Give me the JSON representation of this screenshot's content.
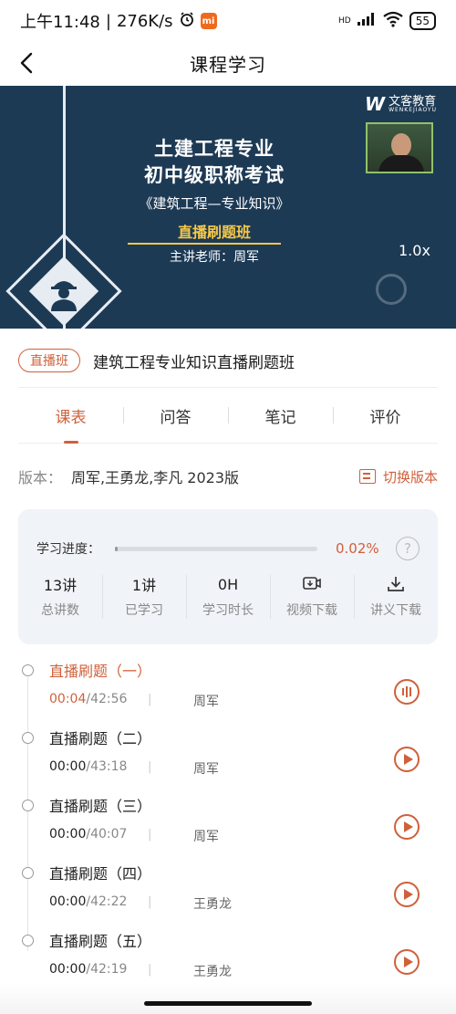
{
  "status_bar": {
    "time": "上午11:48",
    "net_speed": "276K/s",
    "battery": "55",
    "hd_label": "HD"
  },
  "header": {
    "title": "课程学习",
    "back_icon": "chevron-left-icon"
  },
  "video": {
    "line1": "土建工程专业",
    "line2": "初中级职称考试",
    "line3": "《建筑工程—专业知识》",
    "line4": "直播刷题班",
    "line5": "主讲老师：周军",
    "logo_text": "文客教育",
    "logo_sub": "WENKEJIAOYU",
    "speed": "1.0x",
    "accent_color": "#f7c948",
    "background_color": "#1d3a55"
  },
  "course": {
    "badge": "直播班",
    "name": "建筑工程专业知识直播刷题班"
  },
  "tabs": [
    {
      "label": "课表",
      "active": true
    },
    {
      "label": "问答",
      "active": false
    },
    {
      "label": "笔记",
      "active": false
    },
    {
      "label": "评价",
      "active": false
    }
  ],
  "version": {
    "label": "版本：",
    "value": "周军,王勇龙,李凡 2023版",
    "switch_label": "切换版本"
  },
  "progress": {
    "label": "学习进度：",
    "percent_text": "0.02%",
    "fraction": 0.0002,
    "help": "?"
  },
  "stats": [
    {
      "value": "13讲",
      "label": "总讲数"
    },
    {
      "value": "1讲",
      "label": "已学习"
    },
    {
      "value": "0H",
      "label": "学习时长"
    },
    {
      "icon": "video-download-icon",
      "label": "视频下载"
    },
    {
      "icon": "download-icon",
      "label": "讲义下载"
    }
  ],
  "lessons": [
    {
      "title": "直播刷题（一）",
      "watched": "00:04",
      "duration": "/42:56",
      "teacher": "周军",
      "current": true
    },
    {
      "title": "直播刷题（二）",
      "watched": "00:00",
      "duration": "/43:18",
      "teacher": "周军",
      "current": false
    },
    {
      "title": "直播刷题（三）",
      "watched": "00:00",
      "duration": "/40:07",
      "teacher": "周军",
      "current": false
    },
    {
      "title": "直播刷题（四）",
      "watched": "00:00",
      "duration": "/42:22",
      "teacher": "王勇龙",
      "current": false
    },
    {
      "title": "直播刷题（五）",
      "watched": "00:00",
      "duration": "/42:19",
      "teacher": "王勇龙",
      "current": false
    }
  ],
  "colors": {
    "accent": "#d0603a",
    "card_bg": "#f0f3f8"
  }
}
